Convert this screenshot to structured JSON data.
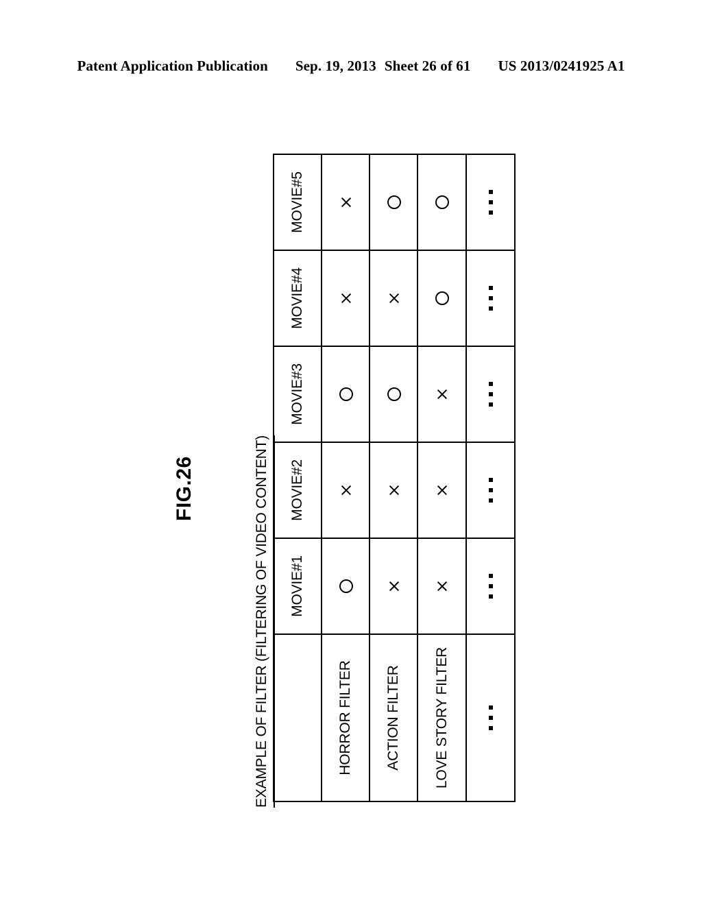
{
  "patent_header": {
    "publication": "Patent Application Publication",
    "date": "Sep. 19, 2013",
    "sheet": "Sheet 26 of 61",
    "number": "US 2013/0241925 A1"
  },
  "figure": {
    "label": "FIG.26",
    "caption": "EXAMPLE OF FILTER (FILTERING OF VIDEO CONTENT)"
  },
  "chart_data": {
    "type": "table",
    "title": "EXAMPLE OF FILTER (FILTERING OF VIDEO CONTENT)",
    "corner_label": "",
    "columns": [
      "MOVIE#1",
      "MOVIE#2",
      "MOVIE#3",
      "MOVIE#4",
      "MOVIE#5",
      "..."
    ],
    "rows": [
      "HORROR FILTER",
      "ACTION FILTER",
      "LOVE STORY FILTER",
      "..."
    ],
    "symbols": {
      "circle": "○",
      "cross": "×",
      "ellipsis": "..."
    },
    "values": [
      [
        "circle",
        "cross",
        "circle",
        "cross",
        "cross",
        "ellipsis"
      ],
      [
        "cross",
        "cross",
        "circle",
        "cross",
        "circle",
        "ellipsis"
      ],
      [
        "cross",
        "cross",
        "cross",
        "circle",
        "circle",
        "ellipsis"
      ],
      [
        "ellipsis",
        "ellipsis",
        "ellipsis",
        "ellipsis",
        "ellipsis",
        "ellipsis"
      ]
    ]
  },
  "colors": {
    "ink": "#000000",
    "paper": "#ffffff"
  }
}
